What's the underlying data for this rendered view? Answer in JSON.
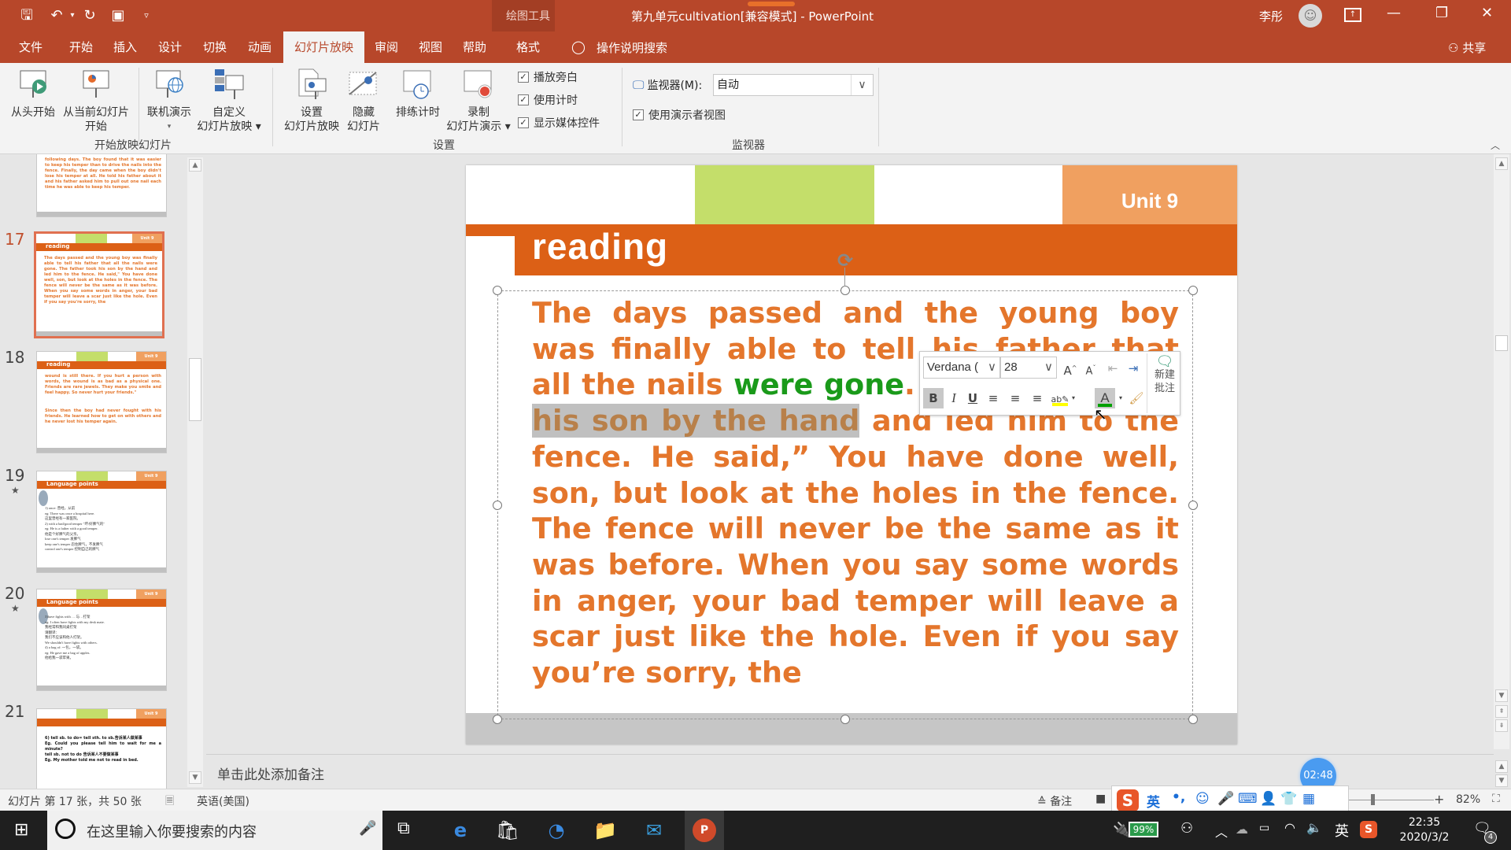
{
  "window": {
    "title": "第九单元cultivation[兼容模式]  -  PowerPoint",
    "context_tab_group": "绘图工具",
    "user_name": "李彤",
    "share_label": "共享",
    "controls": {
      "ribbon_display": "ribbon-display-icon",
      "minimize": "—",
      "restore": "❐",
      "close": "✕"
    }
  },
  "quick_access": [
    "save-icon",
    "undo-icon",
    "redo-icon",
    "present-icon",
    "customize-icon"
  ],
  "tabs": [
    {
      "label": "文件",
      "active": false
    },
    {
      "label": "开始",
      "active": false
    },
    {
      "label": "插入",
      "active": false
    },
    {
      "label": "设计",
      "active": false
    },
    {
      "label": "切换",
      "active": false
    },
    {
      "label": "动画",
      "active": false
    },
    {
      "label": "幻灯片放映",
      "active": true
    },
    {
      "label": "审阅",
      "active": false
    },
    {
      "label": "视图",
      "active": false
    },
    {
      "label": "帮助",
      "active": false
    },
    {
      "label": "格式",
      "active": false
    }
  ],
  "tell_me": "操作说明搜索",
  "ribbon": {
    "groups": [
      {
        "label": "开始放映幻灯片",
        "buttons": [
          {
            "line1": "从头开始",
            "line2": ""
          },
          {
            "line1": "从当前幻灯片",
            "line2": "开始"
          },
          {
            "line1": "联机演示",
            "line2": "▾"
          },
          {
            "line1": "自定义",
            "line2": "幻灯片放映 ▾"
          }
        ]
      },
      {
        "label": "设置",
        "buttons": [
          {
            "line1": "设置",
            "line2": "幻灯片放映"
          },
          {
            "line1": "隐藏",
            "line2": "幻灯片"
          },
          {
            "line1": "排练计时",
            "line2": ""
          },
          {
            "line1": "录制",
            "line2": "幻灯片演示 ▾"
          }
        ],
        "checkboxes": [
          {
            "label": "播放旁白",
            "checked": true
          },
          {
            "label": "使用计时",
            "checked": true
          },
          {
            "label": "显示媒体控件",
            "checked": true
          }
        ]
      },
      {
        "label": "监视器",
        "monitor_label": "监视器(M):",
        "monitor_value": "自动",
        "presenter_view": {
          "label": "使用演示者视图",
          "checked": true
        }
      }
    ]
  },
  "thumbnails": [
    {
      "number": "",
      "has_star": false,
      "selected": false,
      "lines": [
        "following days. The boy found that it was easier to keep his temper than to drive the nails into the fence. Finally, the day came when the boy didn't lose his temper at all. He told his father about it and his father asked him to pull out one nail each time he was able to keep his temper."
      ]
    },
    {
      "number": "17",
      "has_star": false,
      "selected": true,
      "title": "reading",
      "unit": "Unit 9",
      "lines": [
        "The days passed and the young boy was finally able to tell his father that all the nails were gone. The father took his son by the hand and led him to the fence. He said,\" You have done well, son, but look at the holes in the fence. The fence will never be the same as it was before. When you say some words in anger, your bad temper will leave a scar just like the hole. Even if you say you're sorry, the"
      ]
    },
    {
      "number": "18",
      "has_star": false,
      "selected": false,
      "title": "reading",
      "unit": "Unit 9",
      "lines": [
        "wound is still there. If you hurt a person with words, the wound is as bad as a physical one. Friends are rare jewels. They make you smile and feel happy. So never hurt your friends.\"",
        "Since then the boy had never fought with his friends. He learned how to get on with others and he never lost his temper again."
      ]
    },
    {
      "number": "19",
      "has_star": true,
      "selected": false,
      "title": "Language points",
      "unit": "Unit 9",
      "lines": [
        "1) once: 曾经，从前",
        "eg: There was once a hospital here.",
        "这里曾经有一家医院。",
        "2) with a bad/good temper \"坏/好脾气的\"",
        "eg: He is a father with a good temper.",
        "他是个好脾气的父亲。",
        "lose one's temper   发脾气",
        "keep one's temper   忍住脾气，不发脾气",
        "control one's temper   控制自己的脾气"
      ]
    },
    {
      "number": "20",
      "has_star": true,
      "selected": false,
      "title": "Language points",
      "unit": "Unit 9",
      "lines": [
        "3)have fights with … 与…打架",
        "eg: I often have fights with my desk mate.",
        "我经常和我同桌打架",
        "请翻译：",
        "我们不应该和他人打架。",
        "We shouldn't have fights with others.",
        "4) a bag of: 一包，一袋。",
        "eg: He gave me a bag of apples.",
        "他给我一袋苹果。"
      ]
    },
    {
      "number": "21",
      "has_star": false,
      "selected": false,
      "title": "",
      "unit": "Unit 9",
      "lines": [
        "6) tell sb. to do= tell sth. to sb.告诉某人做某事",
        "Eg. Could you please tell him to wait for me a minute?",
        "tell sb. not to do 告诉某人不要做某事",
        "Eg. My mother told me not to read in bed."
      ]
    }
  ],
  "slide": {
    "unit_label": "Unit 9",
    "title": "reading",
    "body_segments": [
      {
        "text": "The days passed and the young boy was finally able to tell his father that all the nails ",
        "style": "orange"
      },
      {
        "text": "were gone",
        "style": "green"
      },
      {
        "text": ". The father ",
        "style": "orange"
      },
      {
        "text": "took his son by the hand",
        "style": "highlight"
      },
      {
        "text": " and led him to the fence. He said,” You have done well, son, but look at the holes in the fence. The fence will never be the same as it was before. When you say some words in anger, your bad temper will leave a scar just like the hole. Even if you say you’re sorry, the",
        "style": "orange"
      }
    ],
    "colors": {
      "orange_text": "#e4762c",
      "green_text": "#1a9a1a",
      "header_bar": "#dc6016",
      "unit_box": "#f0a060",
      "green_box": "#c4de6a"
    }
  },
  "mini_toolbar": {
    "font_name": "Verdana (",
    "font_size": "28",
    "grow_font": "A",
    "shrink_font": "A",
    "bold": "B",
    "italic": "I",
    "underline": "U",
    "new_comment_line1": "新建",
    "new_comment_line2": "批注",
    "highlight_color": "#ffff00",
    "font_color": "#00a000"
  },
  "notes_placeholder": "单击此处添加备注",
  "timer": "02:48",
  "status": {
    "slide_info": "幻灯片 第 17 张，共 50 张",
    "language": "英语(美国)",
    "notes_label": "备注",
    "comments_label": "批注",
    "zoom": "82%",
    "zoom_level": 0.82
  },
  "ime_bar": {
    "lang": "英",
    "punct": "•,"
  },
  "taskbar": {
    "search_placeholder": "在这里输入你要搜索的内容",
    "battery": "99%",
    "ime_lang": "英",
    "time": "22:35",
    "date": "2020/3/2",
    "notifications": "4",
    "apps": [
      "task-view-icon",
      "edge-icon",
      "store-icon",
      "clock-app-icon",
      "file-explorer-icon",
      "mail-icon",
      "powerpoint-icon"
    ]
  }
}
